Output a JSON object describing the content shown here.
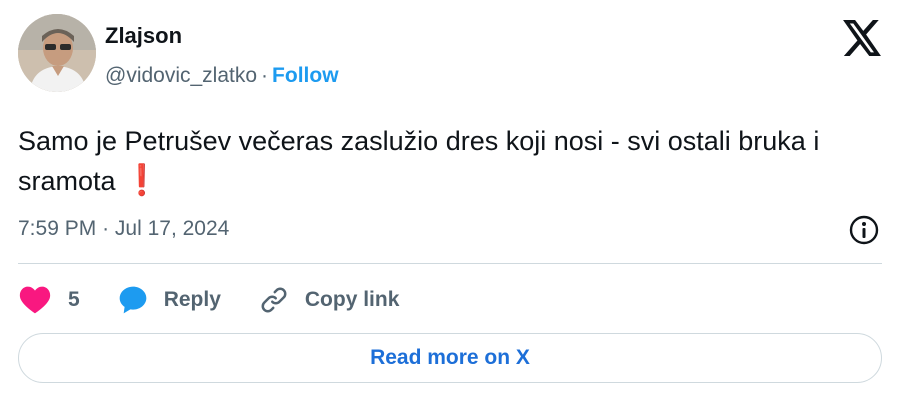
{
  "author": {
    "display_name": "Zlajson",
    "handle": "@vidovic_zlatko",
    "separator": "·",
    "follow_label": "Follow"
  },
  "tweet": {
    "text": "Samo je Petrušev večeras zaslužio dres koji nosi - svi ostali bruka i sramota",
    "emoji": "❗",
    "time": "7:59 PM",
    "date_separator": "·",
    "date": "Jul 17, 2024"
  },
  "actions": {
    "like_count": "5",
    "reply_label": "Reply",
    "copy_link_label": "Copy link"
  },
  "read_more": {
    "label": "Read more on X"
  },
  "colors": {
    "accent": "#1d9bf0",
    "like": "#f91880",
    "text": "#0f1419",
    "muted": "#536471",
    "border": "#cfd9de"
  },
  "icons": {
    "brand": "x-logo-icon",
    "info": "info-icon",
    "like": "heart-icon",
    "reply": "speech-bubble-icon",
    "copy_link": "link-icon"
  }
}
